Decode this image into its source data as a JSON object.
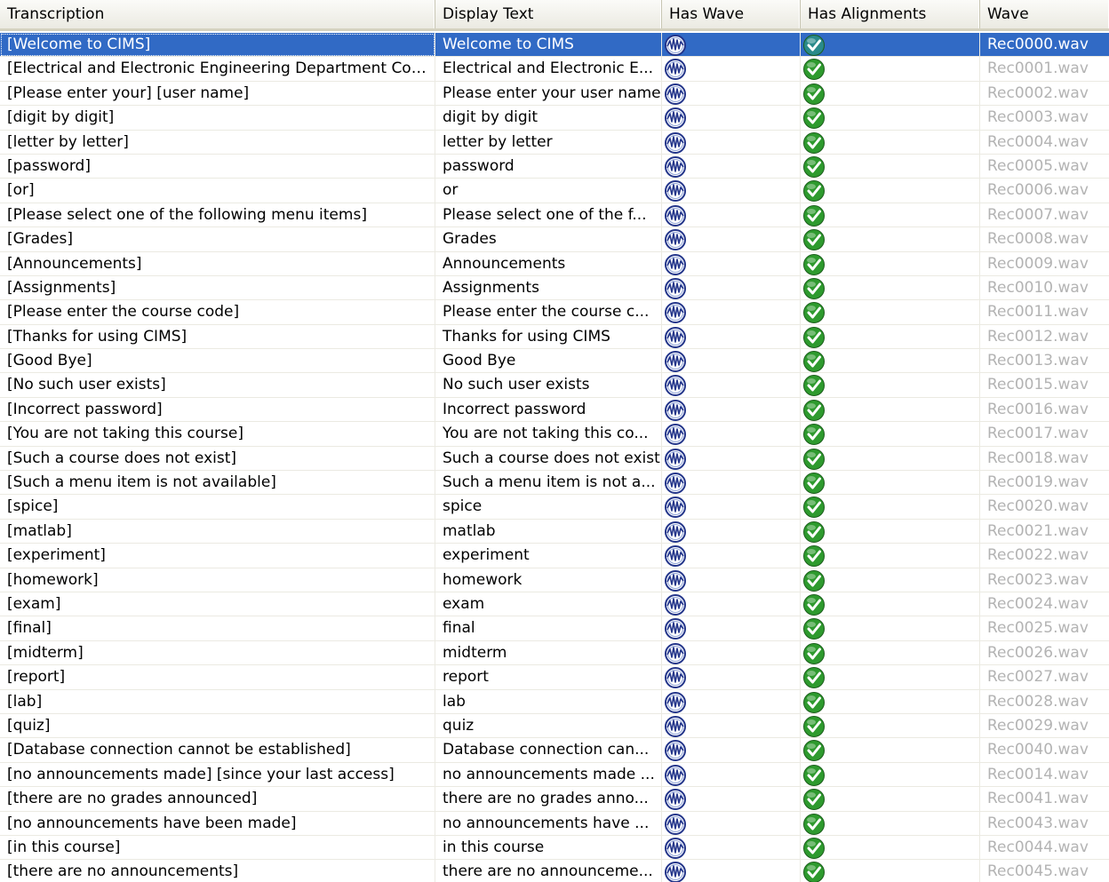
{
  "columns": [
    {
      "key": "transcription",
      "label": "Transcription"
    },
    {
      "key": "display_text",
      "label": "Display Text"
    },
    {
      "key": "has_wave",
      "label": "Has Wave"
    },
    {
      "key": "has_alignments",
      "label": "Has Alignments"
    },
    {
      "key": "wave",
      "label": "Wave"
    }
  ],
  "icons": {
    "has_wave": "waveform-icon",
    "has_alignments": "green-check-icon"
  },
  "colors": {
    "selection": "#316ac5",
    "wave_text": "#b3b3b3",
    "check_green": "#2e9a2e"
  },
  "selected_index": 0,
  "rows": [
    {
      "transcription": "[Welcome to CIMS]",
      "display_text": "Welcome to CIMS",
      "has_wave": true,
      "has_alignments": true,
      "wave": "Rec0000.wav"
    },
    {
      "transcription": "[Electrical and Electronic Engineering Department Cou...",
      "display_text": "Electrical and Electronic E...",
      "has_wave": true,
      "has_alignments": true,
      "wave": "Rec0001.wav"
    },
    {
      "transcription": "[Please enter your] [user name]",
      "display_text": "Please enter your user name",
      "has_wave": true,
      "has_alignments": true,
      "wave": "Rec0002.wav"
    },
    {
      "transcription": "[digit by digit]",
      "display_text": "digit by digit",
      "has_wave": true,
      "has_alignments": true,
      "wave": "Rec0003.wav"
    },
    {
      "transcription": "[letter by letter]",
      "display_text": "letter by letter",
      "has_wave": true,
      "has_alignments": true,
      "wave": "Rec0004.wav"
    },
    {
      "transcription": "[password]",
      "display_text": "password",
      "has_wave": true,
      "has_alignments": true,
      "wave": "Rec0005.wav"
    },
    {
      "transcription": "[or]",
      "display_text": "or",
      "has_wave": true,
      "has_alignments": true,
      "wave": "Rec0006.wav"
    },
    {
      "transcription": "[Please select one of the following menu items]",
      "display_text": "Please select one of the f...",
      "has_wave": true,
      "has_alignments": true,
      "wave": "Rec0007.wav"
    },
    {
      "transcription": "[Grades]",
      "display_text": "Grades",
      "has_wave": true,
      "has_alignments": true,
      "wave": "Rec0008.wav"
    },
    {
      "transcription": "[Announcements]",
      "display_text": "Announcements",
      "has_wave": true,
      "has_alignments": true,
      "wave": "Rec0009.wav"
    },
    {
      "transcription": "[Assignments]",
      "display_text": "Assignments",
      "has_wave": true,
      "has_alignments": true,
      "wave": "Rec0010.wav"
    },
    {
      "transcription": "[Please enter the course code]",
      "display_text": "Please enter the course c...",
      "has_wave": true,
      "has_alignments": true,
      "wave": "Rec0011.wav"
    },
    {
      "transcription": "[Thanks for using CIMS]",
      "display_text": "Thanks for using CIMS",
      "has_wave": true,
      "has_alignments": true,
      "wave": "Rec0012.wav"
    },
    {
      "transcription": "[Good Bye]",
      "display_text": "Good Bye",
      "has_wave": true,
      "has_alignments": true,
      "wave": "Rec0013.wav"
    },
    {
      "transcription": "[No such user exists]",
      "display_text": "No such user exists",
      "has_wave": true,
      "has_alignments": true,
      "wave": "Rec0015.wav"
    },
    {
      "transcription": "[Incorrect password]",
      "display_text": "Incorrect password",
      "has_wave": true,
      "has_alignments": true,
      "wave": "Rec0016.wav"
    },
    {
      "transcription": "[You are not taking this course]",
      "display_text": "You are not taking this co...",
      "has_wave": true,
      "has_alignments": true,
      "wave": "Rec0017.wav"
    },
    {
      "transcription": "[Such a course does not exist]",
      "display_text": "Such a course does not exist",
      "has_wave": true,
      "has_alignments": true,
      "wave": "Rec0018.wav"
    },
    {
      "transcription": "[Such a menu item is not available]",
      "display_text": "Such a menu item is not a...",
      "has_wave": true,
      "has_alignments": true,
      "wave": "Rec0019.wav"
    },
    {
      "transcription": "[spice]",
      "display_text": "spice",
      "has_wave": true,
      "has_alignments": true,
      "wave": "Rec0020.wav"
    },
    {
      "transcription": "[matlab]",
      "display_text": "matlab",
      "has_wave": true,
      "has_alignments": true,
      "wave": "Rec0021.wav"
    },
    {
      "transcription": "[experiment]",
      "display_text": "experiment",
      "has_wave": true,
      "has_alignments": true,
      "wave": "Rec0022.wav"
    },
    {
      "transcription": "[homework]",
      "display_text": "homework",
      "has_wave": true,
      "has_alignments": true,
      "wave": "Rec0023.wav"
    },
    {
      "transcription": "[exam]",
      "display_text": "exam",
      "has_wave": true,
      "has_alignments": true,
      "wave": "Rec0024.wav"
    },
    {
      "transcription": "[final]",
      "display_text": "final",
      "has_wave": true,
      "has_alignments": true,
      "wave": "Rec0025.wav"
    },
    {
      "transcription": "[midterm]",
      "display_text": "midterm",
      "has_wave": true,
      "has_alignments": true,
      "wave": "Rec0026.wav"
    },
    {
      "transcription": "[report]",
      "display_text": "report",
      "has_wave": true,
      "has_alignments": true,
      "wave": "Rec0027.wav"
    },
    {
      "transcription": "[lab]",
      "display_text": "lab",
      "has_wave": true,
      "has_alignments": true,
      "wave": "Rec0028.wav"
    },
    {
      "transcription": "[quiz]",
      "display_text": "quiz",
      "has_wave": true,
      "has_alignments": true,
      "wave": "Rec0029.wav"
    },
    {
      "transcription": "[Database connection cannot be established]",
      "display_text": "Database connection can...",
      "has_wave": true,
      "has_alignments": true,
      "wave": "Rec0040.wav"
    },
    {
      "transcription": "[no announcements made] [since your last access]",
      "display_text": "no announcements made ...",
      "has_wave": true,
      "has_alignments": true,
      "wave": "Rec0014.wav"
    },
    {
      "transcription": "[there are no grades announced]",
      "display_text": "there are no grades anno...",
      "has_wave": true,
      "has_alignments": true,
      "wave": "Rec0041.wav"
    },
    {
      "transcription": "[no announcements have been made]",
      "display_text": "no announcements have ...",
      "has_wave": true,
      "has_alignments": true,
      "wave": "Rec0043.wav"
    },
    {
      "transcription": "[in this course]",
      "display_text": "in this course",
      "has_wave": true,
      "has_alignments": true,
      "wave": "Rec0044.wav"
    },
    {
      "transcription": "[there are no announcements]",
      "display_text": "there are no announceme...",
      "has_wave": true,
      "has_alignments": true,
      "wave": "Rec0045.wav"
    }
  ]
}
